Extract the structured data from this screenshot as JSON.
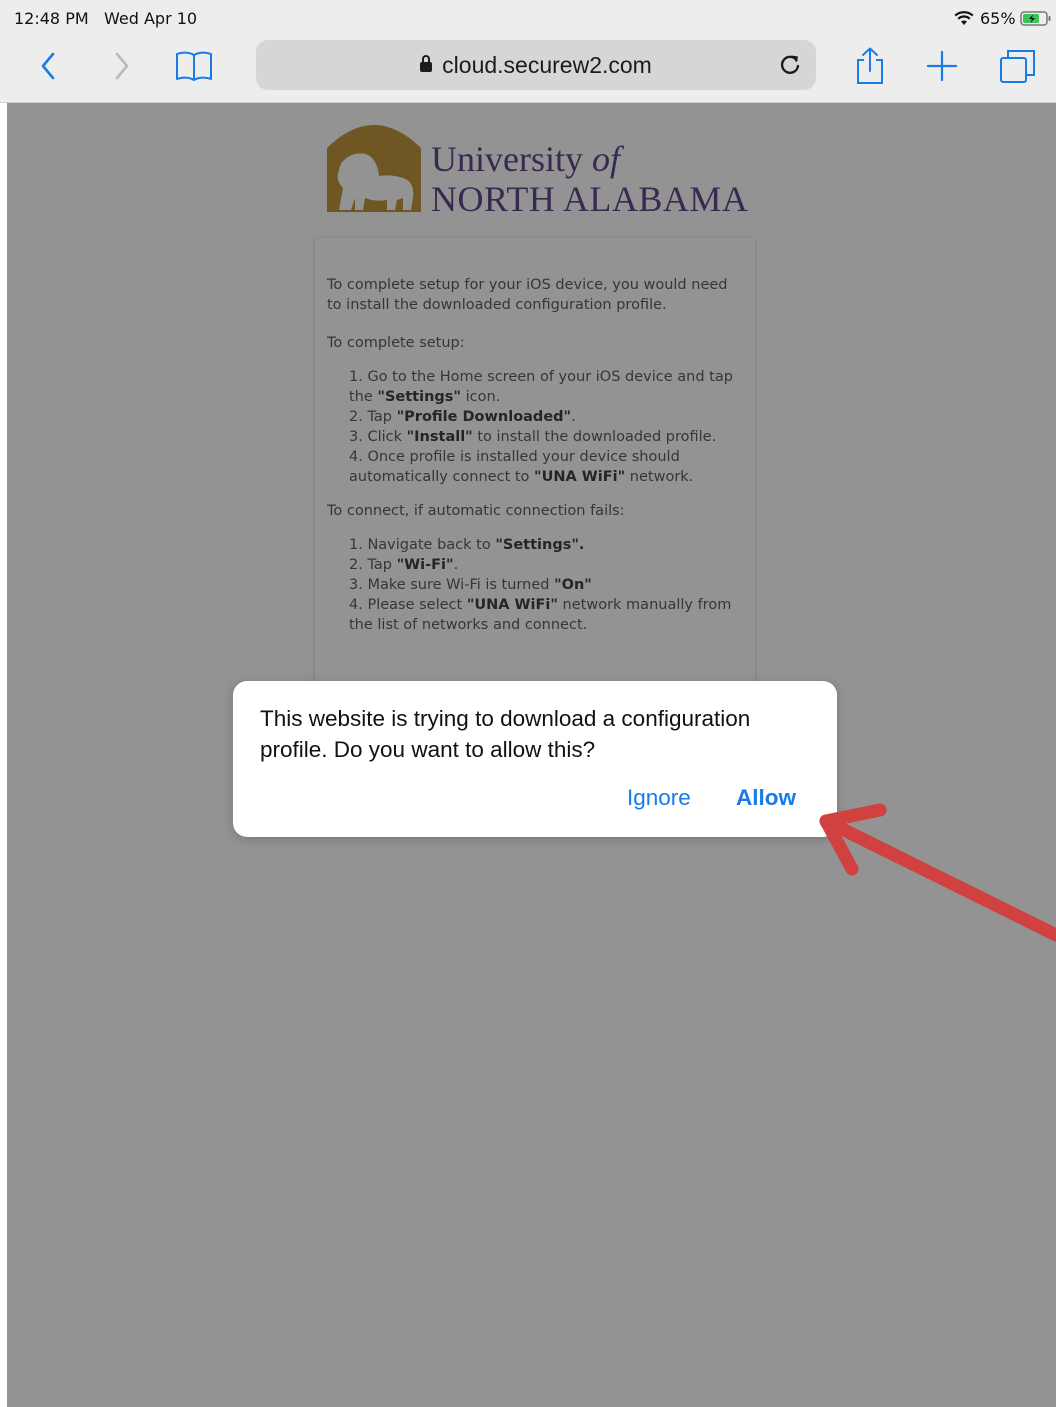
{
  "status_bar": {
    "time": "12:48 PM",
    "date": "Wed Apr 10",
    "battery": "65%"
  },
  "browser": {
    "url": "cloud.securew2.com",
    "icons": {
      "back": "chevron-left-icon",
      "forward": "chevron-right-icon",
      "bookmarks": "book-icon",
      "reload": "reload-icon",
      "share": "share-icon",
      "new_tab": "plus-icon",
      "tabs": "tabs-icon"
    },
    "accent_color": "#1a7ae8"
  },
  "page": {
    "logo": {
      "line1_word": "University ",
      "line1_italic": "of",
      "line2": "NORTH ALABAMA",
      "colors": {
        "gold": "#b7871f",
        "purple": "#4a2b78"
      }
    },
    "intro": "To complete setup for your iOS device, you would need to install the downloaded configuration profile.",
    "setup_heading": "To complete setup:",
    "setup_steps": [
      {
        "pre": "1. Go to the Home screen of your iOS device and tap the ",
        "bold": "\"Settings\"",
        "post": " icon."
      },
      {
        "pre": "2. Tap ",
        "bold": "\"Profile Downloaded\"",
        "post": "."
      },
      {
        "pre": "3. Click ",
        "bold": "\"Install\"",
        "post": " to install the downloaded profile."
      },
      {
        "pre": "4. Once profile is installed your device should automatically connect to ",
        "bold": "\"UNA WiFi\"",
        "post": " network."
      }
    ],
    "fallback_heading": "To connect, if automatic connection fails:",
    "fallback_steps": [
      {
        "pre": "1. Navigate back to ",
        "bold": "\"Settings\".",
        "post": ""
      },
      {
        "pre": "2. Tap ",
        "bold": "\"Wi-Fi\"",
        "post": "."
      },
      {
        "pre": "3. Make sure Wi-Fi is turned ",
        "bold": "\"On\"",
        "post": ""
      },
      {
        "pre": "4. Please select ",
        "bold": "\"UNA WiFi\"",
        "post": " network manually from the list of networks and connect."
      }
    ]
  },
  "dialog": {
    "message": "This website is trying to download a configuration profile. Do you want to allow this?",
    "ignore_label": "Ignore",
    "allow_label": "Allow"
  },
  "annotation": {
    "arrow_color": "#d0413f"
  }
}
